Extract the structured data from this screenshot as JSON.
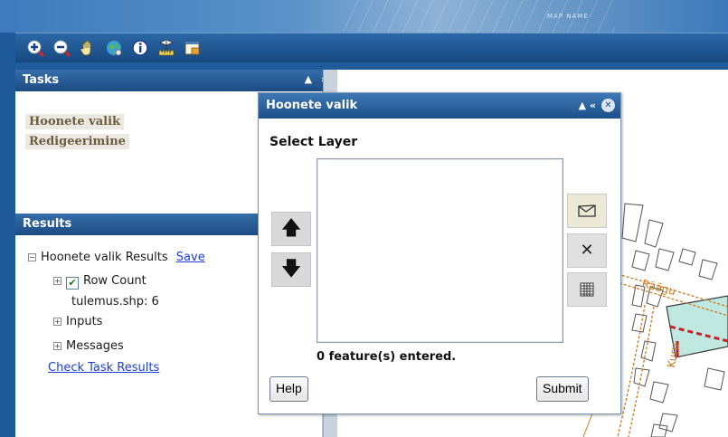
{
  "banner": {
    "map_name": "MAP NAME"
  },
  "toolbar": {
    "tools": [
      {
        "name": "zoom-in-icon"
      },
      {
        "name": "zoom-out-icon"
      },
      {
        "name": "pan-hand-icon"
      },
      {
        "name": "full-extent-globe-icon"
      },
      {
        "name": "identify-icon"
      },
      {
        "name": "measure-icon"
      },
      {
        "name": "overview-map-icon"
      }
    ]
  },
  "tasks": {
    "title": "Tasks",
    "controls": "▲ »",
    "items": [
      "Hoonete valik",
      "Redigeerimine"
    ]
  },
  "results": {
    "title": "Results",
    "controls": "»",
    "root_label": "Hoonete valik Results",
    "save_link": "Save",
    "row_count_label": "Row Count",
    "row_count_value": "tulemus.shp: 6",
    "inputs_label": "Inputs",
    "messages_label": "Messages",
    "check_link": "Check Task Results"
  },
  "dialog": {
    "title": "Hoonete valik",
    "controls": "▲  «",
    "close": "✕",
    "select_layer_label": "Select Layer",
    "status_text": "0 feature(s) entered.",
    "help_button": "Help",
    "submit_button": "Submit"
  },
  "map": {
    "street_label_1": "Räägu",
    "street_label_2": "Kuru"
  },
  "colors": {
    "header_blue": "#1c4b83",
    "task_text": "#6b5d3d",
    "link_blue": "#1c3fd6",
    "feature_fill": "#bfe8e0",
    "road_orange": "#c97a1e"
  }
}
